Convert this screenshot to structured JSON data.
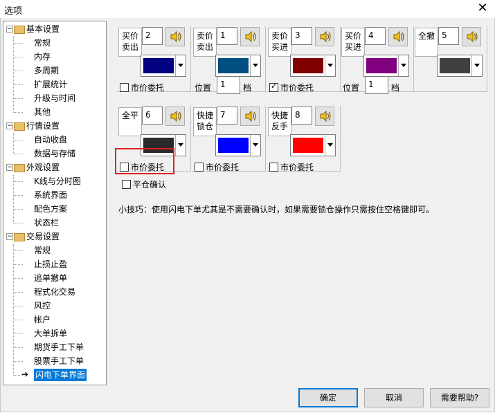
{
  "window": {
    "title": "选项",
    "close_glyph": "✕"
  },
  "tree": {
    "groups": [
      {
        "label": "基本设置",
        "children": [
          "常规",
          "内存",
          "多周期",
          "扩展统计",
          "升级与时间",
          "其他"
        ]
      },
      {
        "label": "行情设置",
        "children": [
          "自动收盘",
          "数据与存储"
        ]
      },
      {
        "label": "外观设置",
        "children": [
          "K线与分时图",
          "系统界面",
          "配色方案",
          "状态栏"
        ]
      },
      {
        "label": "交易设置",
        "children": [
          "常规",
          "止损止盈",
          "追单撤单",
          "程式化交易",
          "风控",
          "帐户",
          "大单拆单",
          "期货手工下单",
          "股票手工下单",
          "闪电下单界面"
        ]
      }
    ],
    "selected": "闪电下单界面"
  },
  "row1": [
    {
      "label_line1": "买价",
      "label_line2": "卖出",
      "value": "2",
      "color": "#000080",
      "extra": {
        "type": "checkbox",
        "checked": false,
        "text": "市价委托"
      }
    },
    {
      "label_line1": "卖价",
      "label_line2": "卖出",
      "value": "1",
      "color": "#004f80",
      "extra": {
        "type": "position",
        "label": "位置",
        "value": "1",
        "unit": "档"
      }
    },
    {
      "label_line1": "卖价",
      "label_line2": "买进",
      "value": "3",
      "color": "#800000",
      "extra": {
        "type": "checkbox",
        "checked": true,
        "text": "市价委托"
      }
    },
    {
      "label_line1": "买价",
      "label_line2": "买进",
      "value": "4",
      "color": "#800080",
      "extra": {
        "type": "position",
        "label": "位置",
        "value": "1",
        "unit": "档"
      }
    },
    {
      "label_line1": "全撤",
      "label_line2": "",
      "value": "5",
      "color": "#404040",
      "extra": null
    }
  ],
  "row2": [
    {
      "label_line1": "全平",
      "label_line2": "",
      "value": "6",
      "color": "#2a2a2a",
      "extra": {
        "type": "checkbox",
        "checked": false,
        "text": "市价委托"
      }
    },
    {
      "label_line1": "快捷",
      "label_line2": "锁仓",
      "value": "7",
      "color": "#0000ff",
      "extra": {
        "type": "checkbox",
        "checked": false,
        "text": "市价委托"
      }
    },
    {
      "label_line1": "快捷",
      "label_line2": "反手",
      "value": "8",
      "color": "#ff0000",
      "extra": {
        "type": "checkbox",
        "checked": false,
        "text": "市价委托"
      }
    }
  ],
  "close_confirm": {
    "checked": false,
    "text": "平仓确认"
  },
  "tip": "小技巧：使用闪电下单尤其是不需要确认时，如果需要锁仓操作只需按住空格键即可。",
  "buttons": {
    "ok": "确定",
    "cancel": "取消",
    "help": "需要帮助?"
  }
}
